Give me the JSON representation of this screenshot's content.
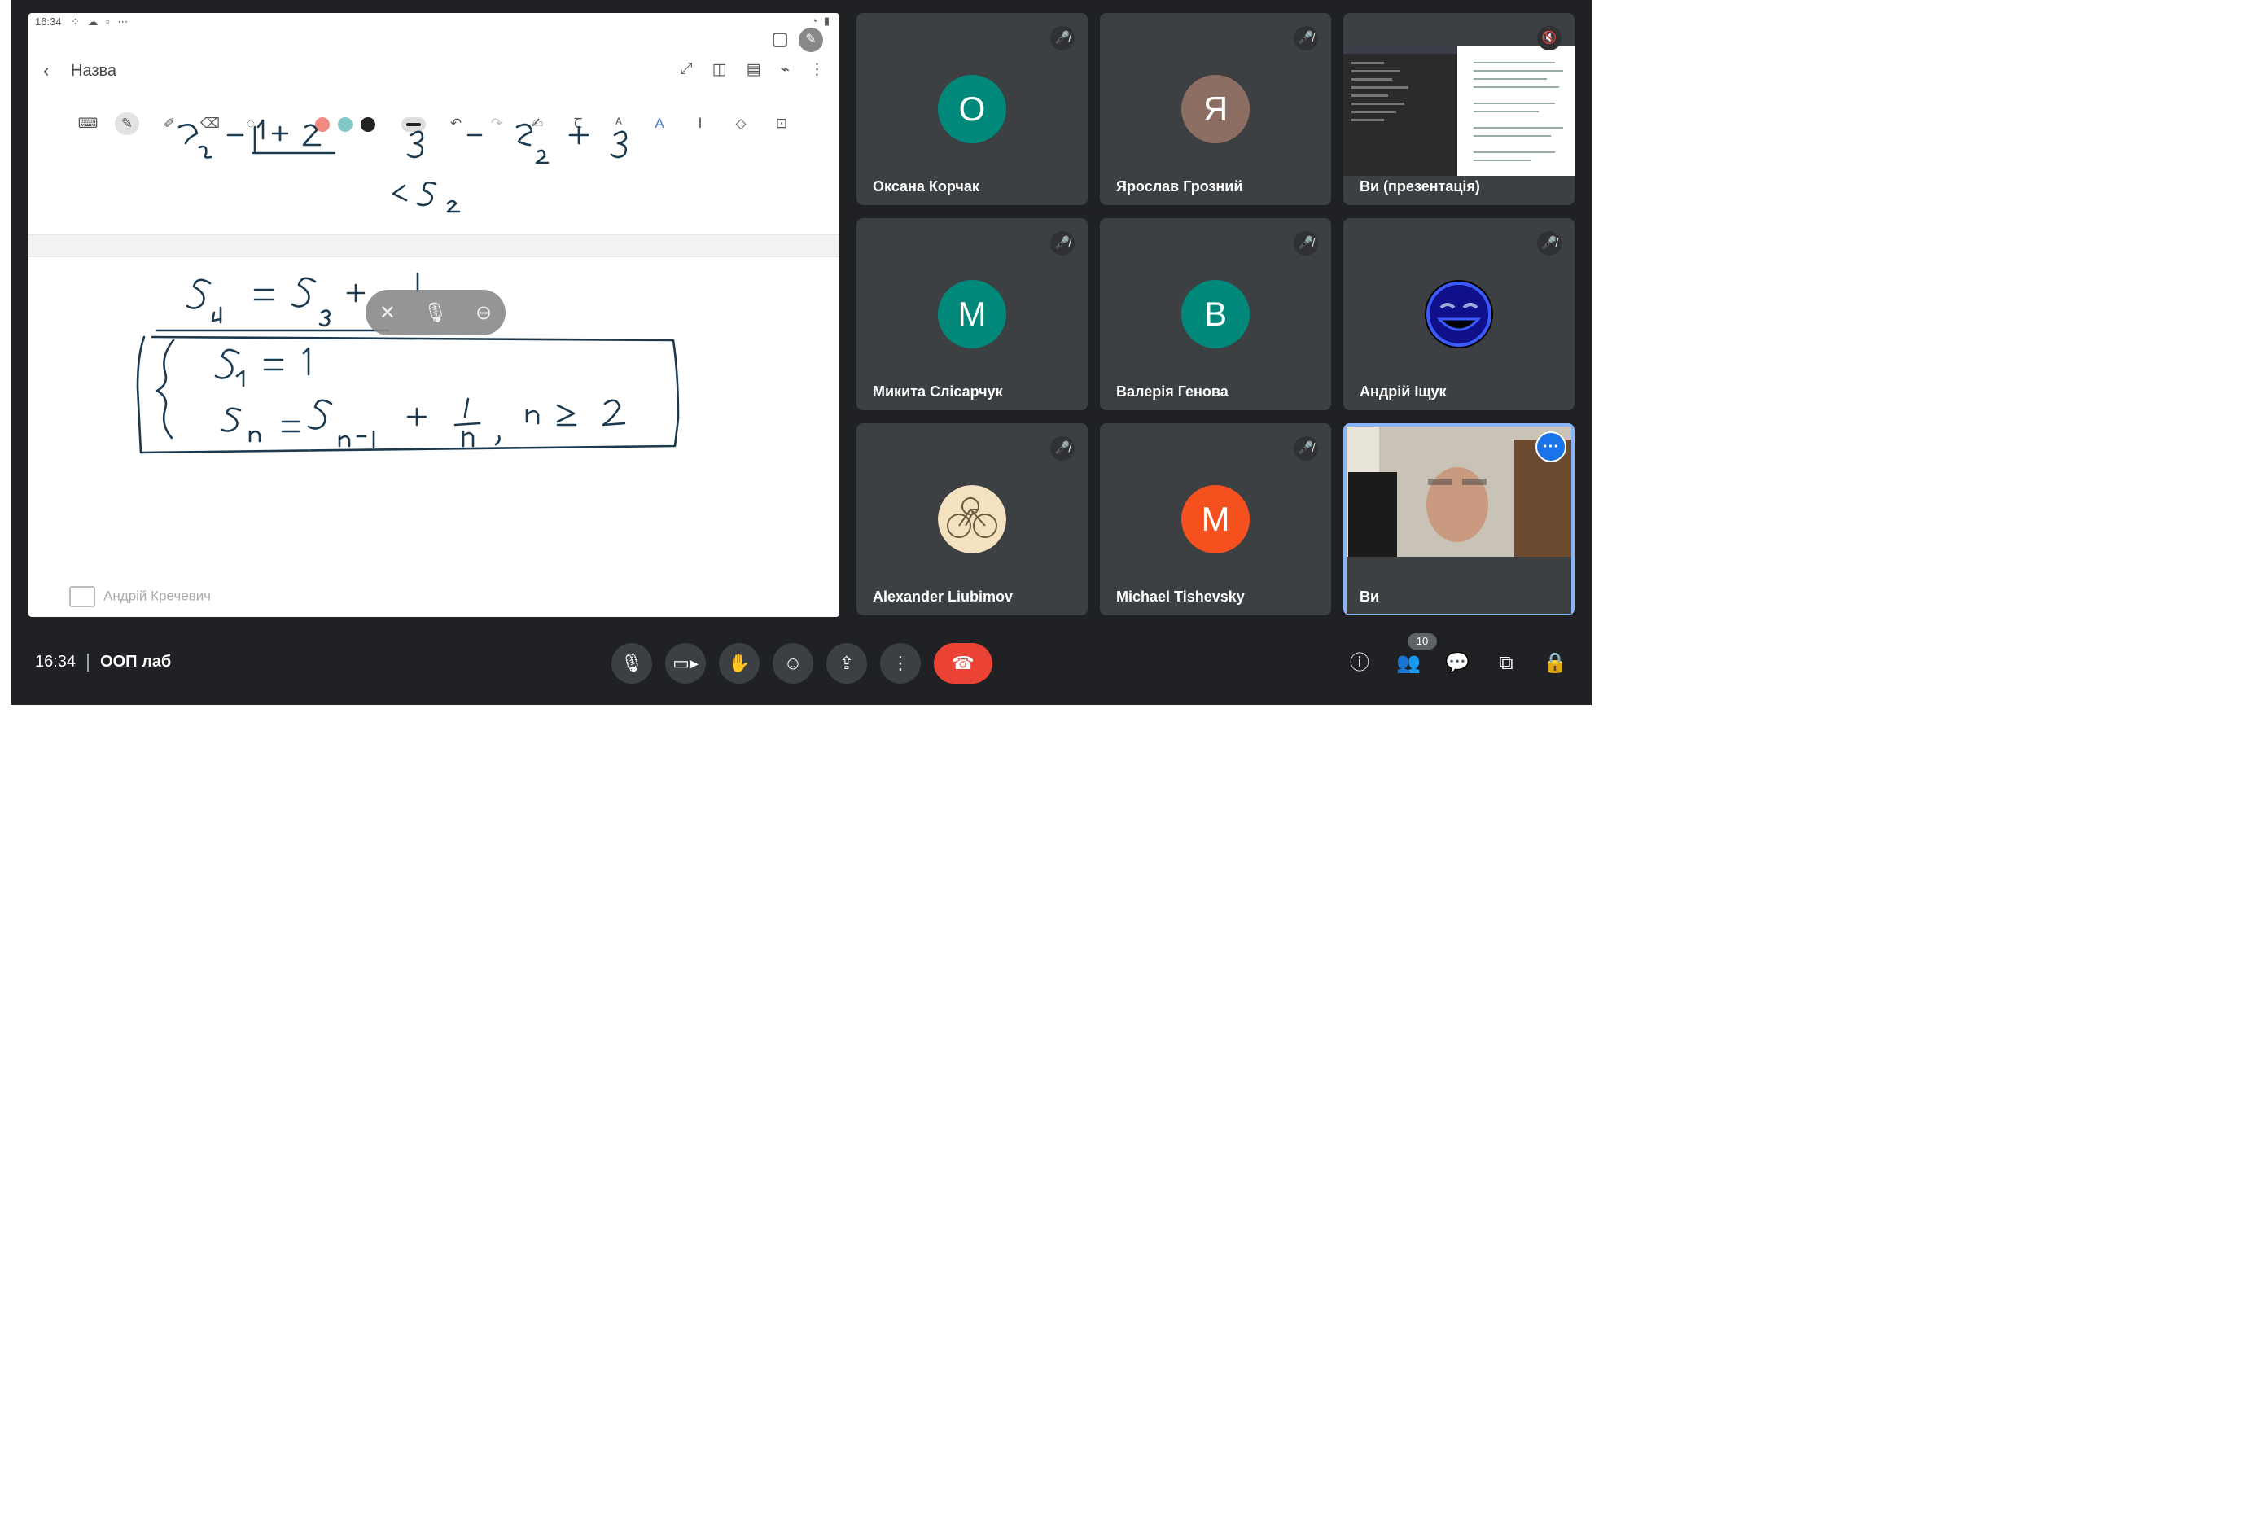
{
  "presentation": {
    "status_time": "16:34",
    "notebook_title": "Назва",
    "presenter_name": "Андрій Кречевич",
    "ink_colors": [
      "#f28b82",
      "#81c9c9",
      "#222222"
    ]
  },
  "participants": [
    {
      "name": "Оксана Корчак",
      "initial": "О",
      "avatar_color": "#00897b",
      "muted": true
    },
    {
      "name": "Ярослав Грозний",
      "initial": "Я",
      "avatar_color": "#8d6e63",
      "muted": true
    },
    {
      "name": "Ви (презентація)",
      "initial": "",
      "avatar_color": "",
      "muted": true
    },
    {
      "name": "Микита Слісарчук",
      "initial": "М",
      "avatar_color": "#00897b",
      "muted": true
    },
    {
      "name": "Валерія Генова",
      "initial": "В",
      "avatar_color": "#00897b",
      "muted": true
    },
    {
      "name": "Андрій Іщук",
      "initial": "",
      "avatar_color": "#1a1aa8",
      "muted": true
    },
    {
      "name": "Alexander Liubimov",
      "initial": "",
      "avatar_color": "#f3e1bf",
      "muted": true
    },
    {
      "name": "Michael Tishevsky",
      "initial": "M",
      "avatar_color": "#f4511e",
      "muted": true
    },
    {
      "name": "Ви",
      "initial": "",
      "avatar_color": "",
      "muted": false
    }
  ],
  "bottom_bar": {
    "time": "16:34",
    "meeting_name": "ООП лаб",
    "people_count": "10"
  },
  "colors": {
    "background": "#202124",
    "tile": "#3c4043",
    "end_call": "#ea4335",
    "accent": "#8ab4f8"
  }
}
